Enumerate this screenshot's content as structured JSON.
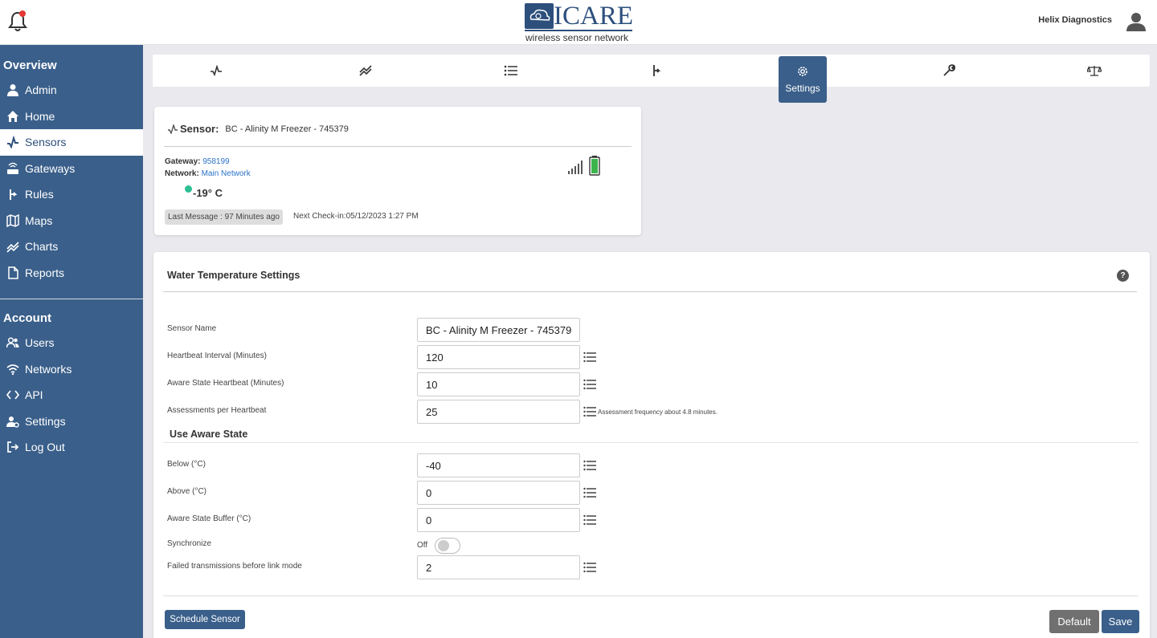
{
  "header": {
    "logo_text": "ICARE",
    "logo_subtitle": "wireless sensor network",
    "org_name": "Helix Diagnostics"
  },
  "sidebar": {
    "sections": [
      {
        "title": "Overview",
        "items": [
          {
            "label": "Admin",
            "icon": "user-icon",
            "active": false
          },
          {
            "label": "Home",
            "icon": "home-icon",
            "active": false
          },
          {
            "label": "Sensors",
            "icon": "sensor-pulse-icon",
            "active": true
          },
          {
            "label": "Gateways",
            "icon": "gateway-icon",
            "active": false
          },
          {
            "label": "Rules",
            "icon": "rules-icon",
            "active": false
          },
          {
            "label": "Maps",
            "icon": "map-icon",
            "active": false
          },
          {
            "label": "Charts",
            "icon": "chart-icon",
            "active": false
          },
          {
            "label": "Reports",
            "icon": "file-icon",
            "active": false
          }
        ]
      },
      {
        "title": "Account",
        "items": [
          {
            "label": "Users",
            "icon": "users-icon",
            "active": false
          },
          {
            "label": "Networks",
            "icon": "wifi-icon",
            "active": false
          },
          {
            "label": "API",
            "icon": "code-icon",
            "active": false
          },
          {
            "label": "Settings",
            "icon": "user-gear-icon",
            "active": false
          },
          {
            "label": "Log Out",
            "icon": "logout-icon",
            "active": false
          }
        ]
      }
    ]
  },
  "tabs": {
    "items": [
      {
        "icon": "pulse-icon"
      },
      {
        "icon": "chart-line-icon"
      },
      {
        "icon": "list-icon"
      },
      {
        "icon": "rules-icon"
      },
      {
        "icon": "gear-icon",
        "label": "Settings",
        "active": true
      },
      {
        "icon": "wrench-icon"
      },
      {
        "icon": "scale-icon"
      }
    ]
  },
  "sensor": {
    "label": "Sensor:",
    "name": "BC - Alinity M Freezer - 745379",
    "gateway_label": "Gateway:",
    "gateway_value": "958199",
    "network_label": "Network:",
    "network_value": "Main Network",
    "temperature": "-19° C",
    "last_message": "Last Message : 97 Minutes ago",
    "next_checkin": "Next Check-in:05/12/2023 1:27 PM",
    "status_color": "#2cbf94",
    "battery_color": "#3cb44b"
  },
  "settings": {
    "title": "Water Temperature Settings",
    "help": "?",
    "fields_top": [
      {
        "label": "Sensor Name",
        "value": "BC - Alinity M Freezer - 745379",
        "has_list": false,
        "note": ""
      },
      {
        "label": "Heartbeat Interval (Minutes)",
        "value": "120",
        "has_list": true,
        "note": ""
      },
      {
        "label": "Aware State Heartbeat (Minutes)",
        "value": "10",
        "has_list": true,
        "note": ""
      },
      {
        "label": "Assessments per Heartbeat",
        "value": "25",
        "has_list": true,
        "note": "Assessment frequency about 4.8 minutes."
      }
    ],
    "aware_heading": "Use Aware State",
    "fields_aware": [
      {
        "label": "Below (°C)",
        "value": "-40",
        "has_list": true
      },
      {
        "label": "Above (°C)",
        "value": "0",
        "has_list": true
      },
      {
        "label": "Aware State Buffer (°C)",
        "value": "0",
        "has_list": true
      }
    ],
    "synchronize": {
      "label": "Synchronize",
      "state": "Off"
    },
    "failed_tx": {
      "label": "Failed transmissions before link mode",
      "value": "2"
    },
    "buttons": {
      "schedule": "Schedule Sensor",
      "default": "Default",
      "save": "Save"
    }
  },
  "colors": {
    "primary": "#3a5f8a",
    "link": "#2b73c6",
    "notification": "#e53935"
  }
}
